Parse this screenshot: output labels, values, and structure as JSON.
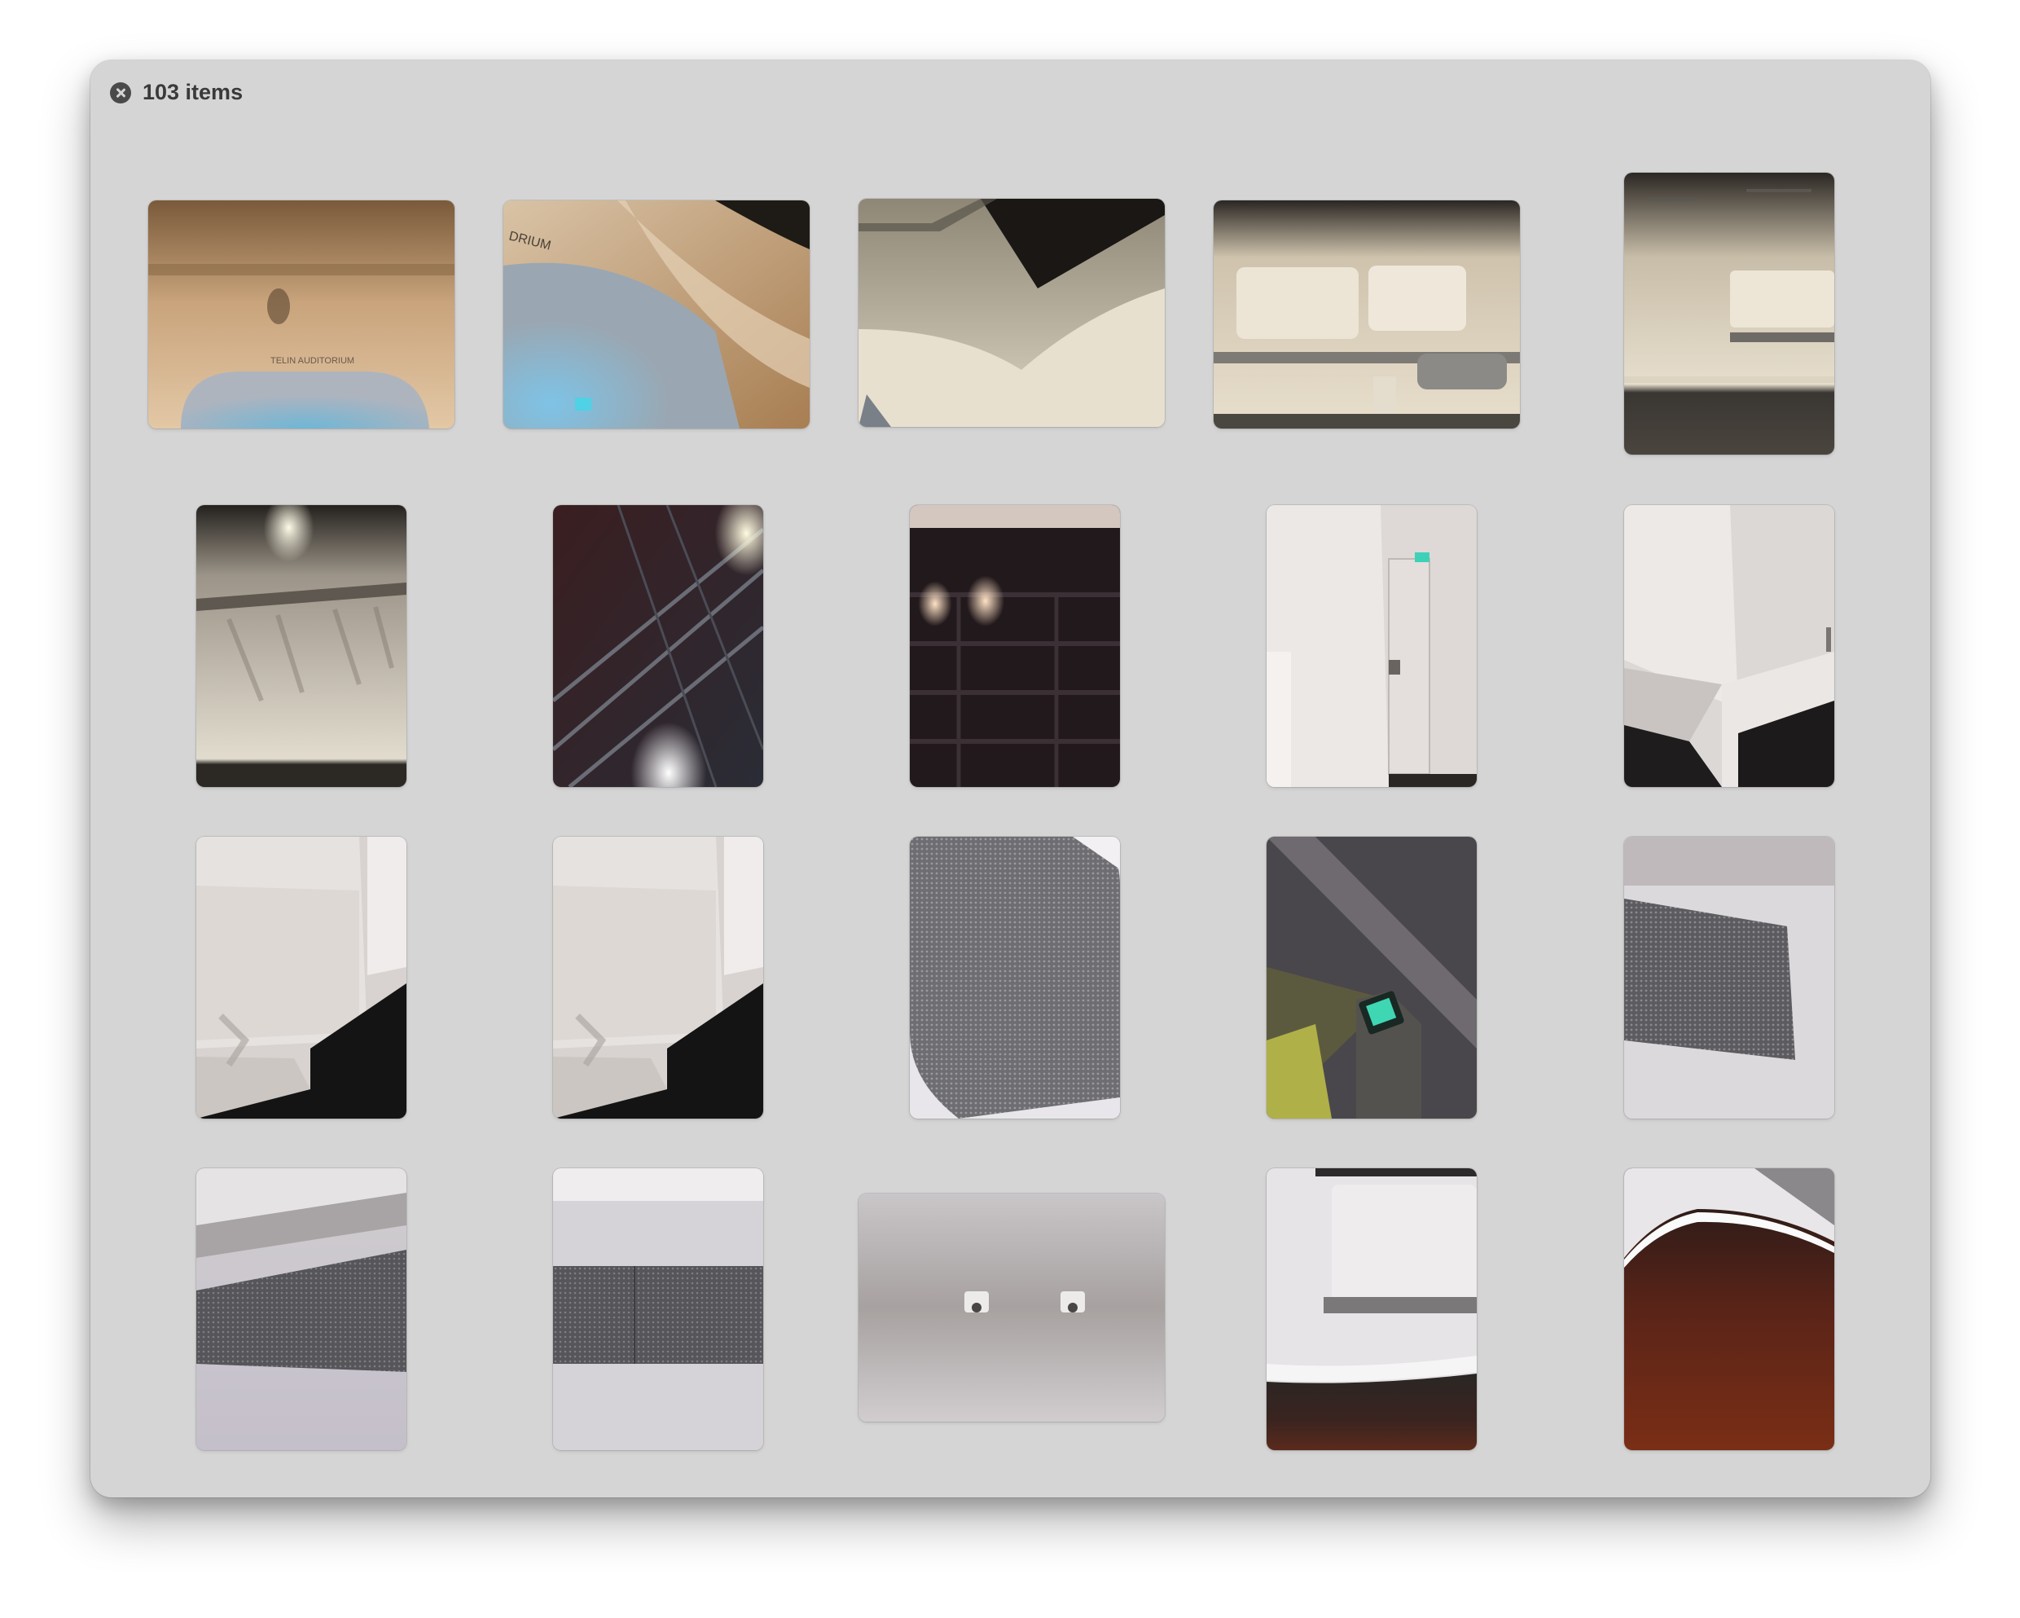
{
  "viewer": {
    "item_count": "103 items"
  },
  "icons": {
    "close": "close-icon"
  },
  "photos": [
    {
      "scene": "ceiling-truss-warm",
      "orientation": "landscape",
      "caption": "TELIN AUDITORIUM"
    },
    {
      "scene": "curved-wall-blue-light",
      "orientation": "landscape",
      "caption": "DRIUM"
    },
    {
      "scene": "curved-wall-v-shape",
      "orientation": "landscape"
    },
    {
      "scene": "panels-wall-wide",
      "orientation": "landscape"
    },
    {
      "scene": "room-corner-ceiling",
      "orientation": "portrait"
    },
    {
      "scene": "lit-wall-truss",
      "orientation": "portrait"
    },
    {
      "scene": "dark-ceiling-lights",
      "orientation": "portrait"
    },
    {
      "scene": "dark-grid-spotlights",
      "orientation": "portrait"
    },
    {
      "scene": "white-door",
      "orientation": "portrait"
    },
    {
      "scene": "white-wall-floor",
      "orientation": "portrait"
    },
    {
      "scene": "white-wall-closeup-a",
      "orientation": "portrait"
    },
    {
      "scene": "white-wall-closeup-b",
      "orientation": "portrait"
    },
    {
      "scene": "mesh-panel-angle",
      "orientation": "portrait"
    },
    {
      "scene": "exit-sign-dark",
      "orientation": "portrait"
    },
    {
      "scene": "mesh-panel-flat",
      "orientation": "portrait"
    },
    {
      "scene": "mesh-band-a",
      "orientation": "portrait"
    },
    {
      "scene": "mesh-band-b",
      "orientation": "portrait"
    },
    {
      "scene": "wall-hooks",
      "orientation": "landscape"
    },
    {
      "scene": "room-floor-red",
      "orientation": "portrait"
    },
    {
      "scene": "curve-red-floor",
      "orientation": "portrait"
    }
  ]
}
